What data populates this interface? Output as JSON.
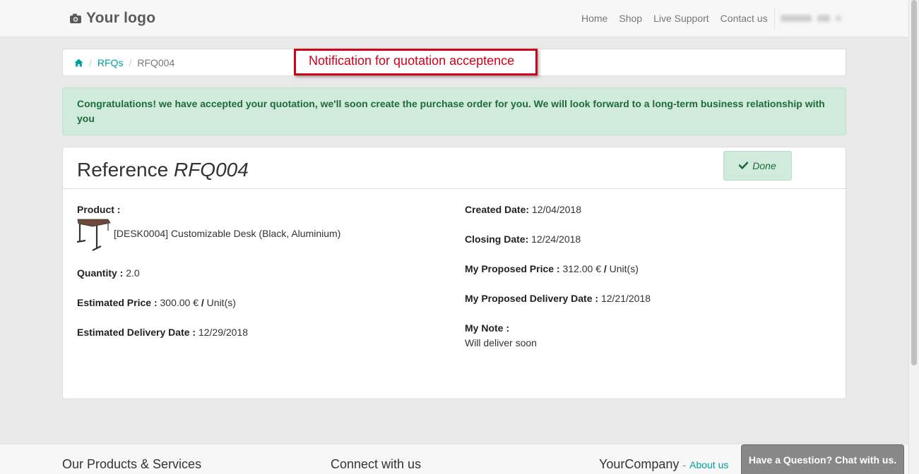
{
  "navbar": {
    "logo_text": "Your logo",
    "links": [
      "Home",
      "Shop",
      "Live Support",
      "Contact us"
    ]
  },
  "breadcrumb": {
    "rfqs": "RFQs",
    "current": "RFQ004"
  },
  "annotation": "Notification for quotation acceptence",
  "alert": "Congratulations! we have accepted your quotation, we'll soon create the purchase order for you. We will look forward to a long-term business relationship with you",
  "reference": {
    "prefix": "Reference",
    "code": "RFQ004",
    "status_label": "Done"
  },
  "details_left": {
    "product_label": "Product :",
    "product_name": "[DESK0004] Customizable Desk (Black, Aluminium)",
    "quantity_label": "Quantity :",
    "quantity_value": "2.0",
    "est_price_label": "Estimated Price :",
    "est_price_value": "300.00 €",
    "est_price_sep": "/",
    "est_price_unit": "Unit(s)",
    "est_delivery_label": "Estimated Delivery Date :",
    "est_delivery_value": "12/29/2018"
  },
  "details_right": {
    "created_label": "Created Date:",
    "created_value": "12/04/2018",
    "closing_label": "Closing Date:",
    "closing_value": "12/24/2018",
    "my_price_label": "My Proposed Price :",
    "my_price_value": "312.00 €",
    "my_price_sep": "/",
    "my_price_unit": "Unit(s)",
    "my_delivery_label": "My Proposed Delivery Date :",
    "my_delivery_value": "12/21/2018",
    "note_label": "My Note :",
    "note_value": "Will deliver soon"
  },
  "footer": {
    "products_heading": "Our Products & Services",
    "connect_heading": "Connect with us",
    "company_name": "YourCompany",
    "company_sep": "-",
    "about_link": "About us"
  },
  "chat_button": "Have a Question? Chat with us.",
  "colors": {
    "accent": "#00a09d",
    "success_bg": "#d0ebdc",
    "annotation_red": "#d0021b"
  }
}
